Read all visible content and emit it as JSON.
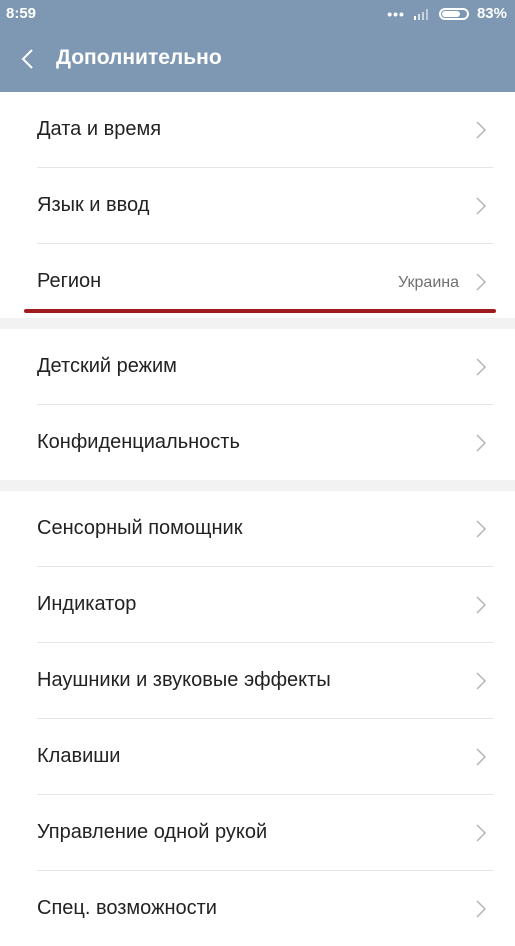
{
  "status": {
    "time": "8:59",
    "dots": "•••",
    "battery_percent": "83%",
    "battery_level": 0.83
  },
  "header": {
    "title": "Дополнительно"
  },
  "group1": [
    {
      "label": "Дата и время"
    },
    {
      "label": "Язык и ввод"
    },
    {
      "label": "Регион",
      "value": "Украина"
    }
  ],
  "group2": [
    {
      "label": "Детский режим"
    },
    {
      "label": "Конфиденциальность"
    }
  ],
  "group3": [
    {
      "label": "Сенсорный помощник"
    },
    {
      "label": "Индикатор"
    },
    {
      "label": "Наушники и звуковые эффекты"
    },
    {
      "label": "Клавиши"
    },
    {
      "label": "Управление одной рукой"
    },
    {
      "label": "Спец. возможности"
    }
  ],
  "colors": {
    "bar": "#7e98b3",
    "highlight": "#a11d1d"
  }
}
